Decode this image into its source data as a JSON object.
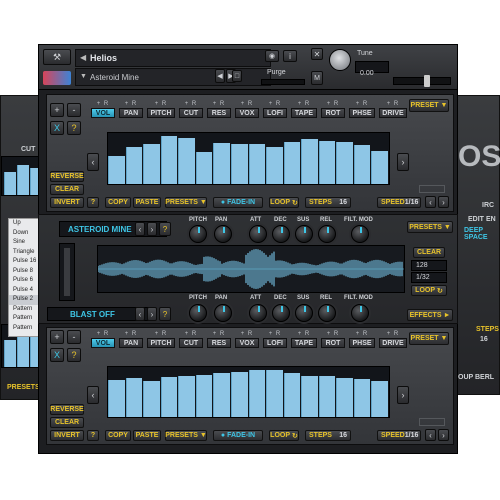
{
  "header": {
    "instrument_name": "Helios",
    "preset_name": "Asteroid Mine",
    "purge_label": "Purge",
    "tune_label": "Tune",
    "tune_value": "0.00",
    "output_label": "M"
  },
  "top_section": {
    "tabs": [
      "VOL",
      "PAN",
      "PITCH",
      "CUT",
      "RES",
      "VOX",
      "LOFI",
      "TAPE",
      "ROT",
      "PHSE",
      "DRIVE"
    ],
    "active_tab": "VOL",
    "preset_label": "PRESET",
    "side_buttons": [
      "REVERSE",
      "CLEAR",
      "INVERT"
    ],
    "copy_label": "COPY",
    "paste_label": "PASTE",
    "presets_label": "PRESETS",
    "fade_in_label": "FADE-IN",
    "loop_label": "LOOP",
    "steps_label": "STEPS",
    "steps_value": "16",
    "speed_label": "SPEED",
    "speed_value": "1/16",
    "question": "?",
    "step_values": [
      0.55,
      0.72,
      0.78,
      0.95,
      0.9,
      0.62,
      0.8,
      0.78,
      0.78,
      0.72,
      0.82,
      0.88,
      0.85,
      0.82,
      0.76,
      0.64
    ]
  },
  "middle_section": {
    "sample_name": "ASTEROID MINE",
    "effect_name": "BLAST OFF",
    "knob_labels_top": [
      "PITCH",
      "PAN",
      "ATT",
      "DEC",
      "SUS",
      "REL",
      "FILT. MOD"
    ],
    "knob_labels_bottom": [
      "PITCH",
      "PAN",
      "ATT",
      "DEC",
      "SUS",
      "REL",
      "FILT. MOD"
    ],
    "presets_label": "PRESETS",
    "effects_label": "EFFECTS",
    "clear_label": "CLEAR",
    "value_128": "128",
    "value_1_32": "1/32",
    "loop_label": "LOOP",
    "question": "?"
  },
  "bottom_section": {
    "tabs": [
      "VOL",
      "PAN",
      "PITCH",
      "CUT",
      "RES",
      "VOX",
      "LOFI",
      "TAPE",
      "ROT",
      "PHSE",
      "DRIVE"
    ],
    "active_tab": "VOL",
    "preset_label": "PRESET",
    "side_buttons": [
      "REVERSE",
      "CLEAR",
      "INVERT"
    ],
    "copy_label": "COPY",
    "paste_label": "PASTE",
    "presets_label": "PRESETS",
    "fade_in_label": "FADE-IN",
    "loop_label": "LOOP",
    "steps_label": "STEPS",
    "steps_value": "16",
    "speed_label": "SPEED",
    "speed_value": "1/16",
    "question": "?",
    "step_values": [
      0.75,
      0.78,
      0.72,
      0.8,
      0.82,
      0.85,
      0.88,
      0.9,
      0.95,
      0.95,
      0.88,
      0.82,
      0.82,
      0.78,
      0.76,
      0.72
    ]
  },
  "left_menu": {
    "items": [
      "Up",
      "Down",
      "Sine",
      "Triangle",
      "Pulse 16",
      "Pulse 8",
      "Pulse 6",
      "Pulse 4",
      "Pulse 2",
      "Pattern",
      "Pattern",
      "Pattern"
    ],
    "selected": "Pulse 2"
  },
  "right_ghost": {
    "logo_fragment": "OS",
    "edit_label": "EDIT",
    "en_label": "EN",
    "deep_space_label": "DEEP SPACE",
    "irc_label": "IRC",
    "steps_label": "STEPS",
    "value_16": "16",
    "footer_text": "OUP  BERL"
  },
  "left_ghost": {
    "cut_label": "CUT",
    "reverse_label": "REVERSE",
    "presets_label": "PRESETS"
  }
}
